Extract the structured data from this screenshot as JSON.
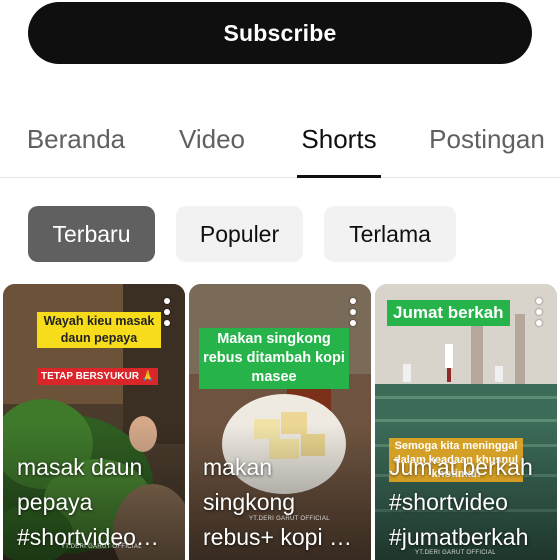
{
  "subscribe": {
    "label": "Subscribe"
  },
  "tabs": [
    {
      "label": "Beranda",
      "active": false
    },
    {
      "label": "Video",
      "active": false
    },
    {
      "label": "Shorts",
      "active": true
    },
    {
      "label": "Postingan",
      "active": false
    }
  ],
  "filters": [
    {
      "label": "Terbaru",
      "active": true
    },
    {
      "label": "Populer",
      "active": false
    },
    {
      "label": "Terlama",
      "active": false
    }
  ],
  "shorts": [
    {
      "title_lines": [
        "masak daun",
        "pepaya",
        "#shortvideo…"
      ],
      "overlay_top": "Wayah kieu masak daun pepaya",
      "overlay_badge": "TETAP BERSYUKUR 🙏",
      "watermark": "YT.DERI GARUT OFFICIAL"
    },
    {
      "title_lines": [
        "makan",
        "singkong",
        "rebus+ kopi …"
      ],
      "overlay_top": "Makan singkong rebus ditambah kopi masee",
      "watermark": "YT.DERI GARUT OFFICIAL"
    },
    {
      "title_lines": [
        "Jum'at berkah",
        "#shortvideo",
        "#jumatberkah"
      ],
      "overlay_top": "Jumat berkah",
      "overlay_badge": "Semoga kita meninggal dalam keadaan khusnul khotimah",
      "watermark": "YT.DERI GARUT OFFICIAL"
    }
  ],
  "colors": {
    "primary": "#0f0f0f",
    "chip_active": "#606060",
    "chip_idle": "#f2f2f2",
    "tab_inactive": "#606060"
  }
}
